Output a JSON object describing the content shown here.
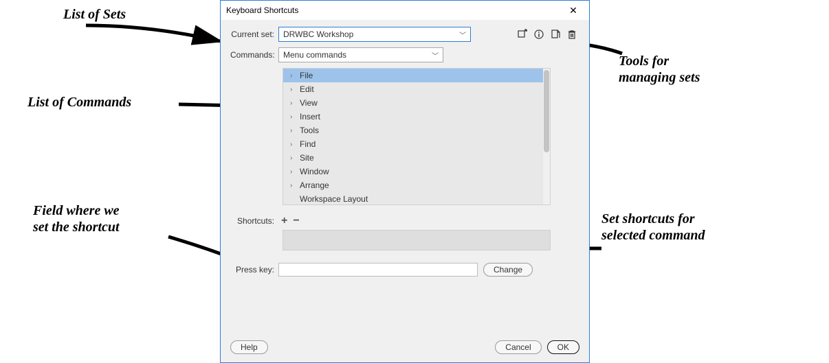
{
  "dialog": {
    "title": "Keyboard Shortcuts",
    "current_set_label": "Current set:",
    "current_set_value": "DRWBC Workshop",
    "commands_label": "Commands:",
    "commands_value": "Menu commands",
    "command_items": [
      {
        "label": "File",
        "expandable": true,
        "selected": true
      },
      {
        "label": "Edit",
        "expandable": true,
        "selected": false
      },
      {
        "label": "View",
        "expandable": true,
        "selected": false
      },
      {
        "label": "Insert",
        "expandable": true,
        "selected": false
      },
      {
        "label": "Tools",
        "expandable": true,
        "selected": false
      },
      {
        "label": "Find",
        "expandable": true,
        "selected": false
      },
      {
        "label": "Site",
        "expandable": true,
        "selected": false
      },
      {
        "label": "Window",
        "expandable": true,
        "selected": false
      },
      {
        "label": "Arrange",
        "expandable": true,
        "selected": false
      },
      {
        "label": "Workspace Layout",
        "expandable": false,
        "selected": false
      }
    ],
    "shortcuts_label": "Shortcuts:",
    "press_key_label": "Press key:",
    "press_key_value": "",
    "change_button": "Change",
    "help_button": "Help",
    "cancel_button": "Cancel",
    "ok_button": "OK"
  },
  "annotations": {
    "list_of_sets": "List of Sets",
    "tools_for_sets_l1": "Tools for",
    "tools_for_sets_l2": "managing sets",
    "list_of_commands": "List of Commands",
    "field_l1": "Field where we",
    "field_l2": "set the shortcut",
    "set_shortcuts_l1": "Set shortcuts for",
    "set_shortcuts_l2": "selected command"
  }
}
